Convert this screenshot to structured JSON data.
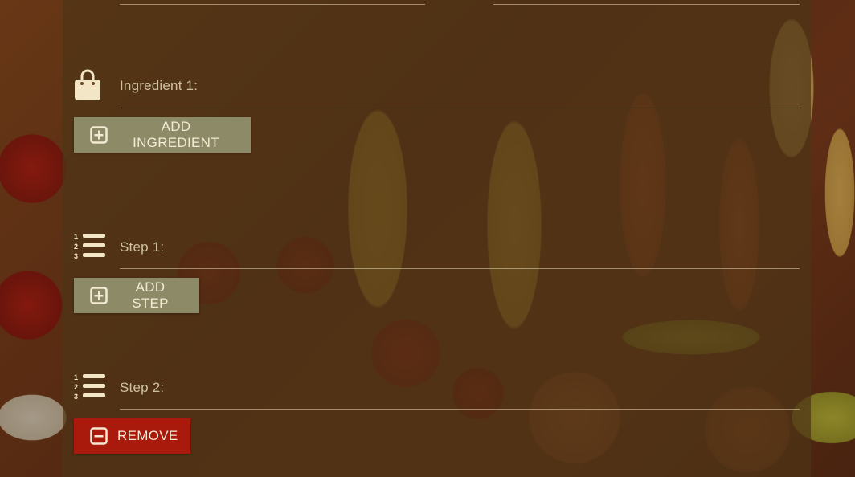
{
  "ingredients": {
    "items": [
      {
        "label": "Ingredient 1:",
        "icon": "shopping-bag-icon"
      }
    ],
    "add_button_label": "ADD INGREDIENT",
    "add_button_icon": "plus-square-icon"
  },
  "steps": {
    "items": [
      {
        "label": "Step 1:",
        "icon": "numbered-list-icon"
      },
      {
        "label": "Step 2:",
        "icon": "numbered-list-icon"
      }
    ],
    "add_button_label": "ADD STEP",
    "add_button_icon": "plus-square-icon",
    "remove_button_label": "REMOVE",
    "remove_button_icon": "minus-square-icon"
  },
  "colors": {
    "panel_overlay": "#4e3416",
    "add_button": "#8d8a68",
    "remove_button": "#a9190c",
    "icon": "#f2e6c6",
    "label": "#cfc2a2"
  }
}
